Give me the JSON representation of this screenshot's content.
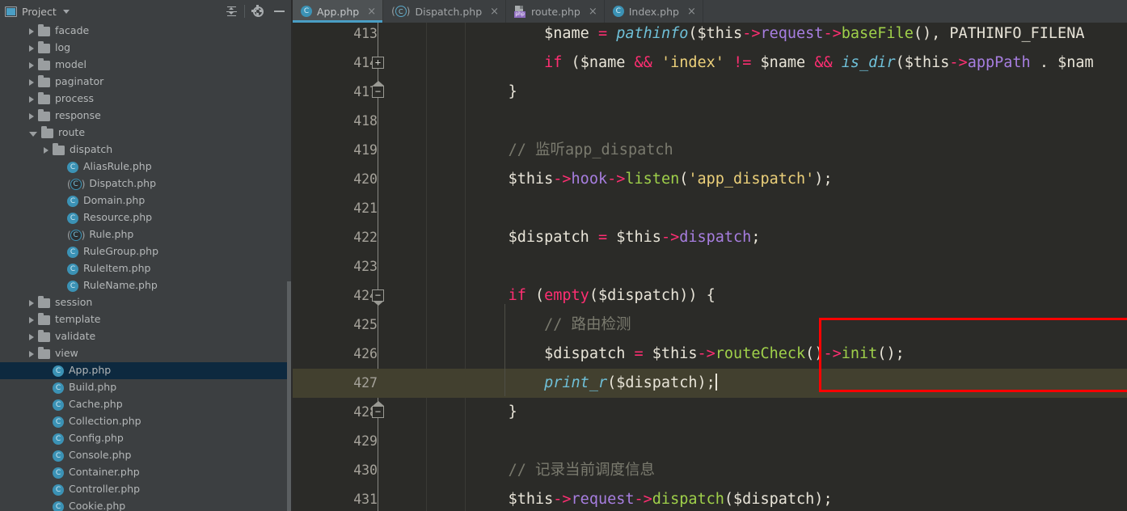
{
  "sidebar": {
    "title": "Project",
    "icons": {
      "project": "project-panel-icon",
      "collapse_all": "collapse-all-icon",
      "settings": "gear-icon",
      "minimize": "minimize-icon"
    },
    "tree": [
      {
        "label": "facade",
        "type": "folder",
        "indent": 2,
        "state": "collapsed"
      },
      {
        "label": "log",
        "type": "folder",
        "indent": 2,
        "state": "collapsed"
      },
      {
        "label": "model",
        "type": "folder",
        "indent": 2,
        "state": "collapsed"
      },
      {
        "label": "paginator",
        "type": "folder",
        "indent": 2,
        "state": "collapsed"
      },
      {
        "label": "process",
        "type": "folder",
        "indent": 2,
        "state": "collapsed"
      },
      {
        "label": "response",
        "type": "folder",
        "indent": 2,
        "state": "collapsed"
      },
      {
        "label": "route",
        "type": "folder",
        "indent": 2,
        "state": "expanded"
      },
      {
        "label": "dispatch",
        "type": "folder",
        "indent": 3,
        "state": "collapsed"
      },
      {
        "label": "AliasRule.php",
        "type": "class",
        "indent": 4,
        "state": "leaf"
      },
      {
        "label": "Dispatch.php",
        "type": "interface",
        "indent": 4,
        "state": "leaf"
      },
      {
        "label": "Domain.php",
        "type": "class",
        "indent": 4,
        "state": "leaf"
      },
      {
        "label": "Resource.php",
        "type": "class",
        "indent": 4,
        "state": "leaf"
      },
      {
        "label": "Rule.php",
        "type": "interface",
        "indent": 4,
        "state": "leaf"
      },
      {
        "label": "RuleGroup.php",
        "type": "class",
        "indent": 4,
        "state": "leaf"
      },
      {
        "label": "RuleItem.php",
        "type": "class",
        "indent": 4,
        "state": "leaf"
      },
      {
        "label": "RuleName.php",
        "type": "class",
        "indent": 4,
        "state": "leaf"
      },
      {
        "label": "session",
        "type": "folder",
        "indent": 2,
        "state": "collapsed"
      },
      {
        "label": "template",
        "type": "folder",
        "indent": 2,
        "state": "collapsed"
      },
      {
        "label": "validate",
        "type": "folder",
        "indent": 2,
        "state": "collapsed"
      },
      {
        "label": "view",
        "type": "folder",
        "indent": 2,
        "state": "collapsed"
      },
      {
        "label": "App.php",
        "type": "class",
        "indent": 3,
        "state": "leaf",
        "selected": true
      },
      {
        "label": "Build.php",
        "type": "class",
        "indent": 3,
        "state": "leaf"
      },
      {
        "label": "Cache.php",
        "type": "class",
        "indent": 3,
        "state": "leaf"
      },
      {
        "label": "Collection.php",
        "type": "class",
        "indent": 3,
        "state": "leaf"
      },
      {
        "label": "Config.php",
        "type": "class",
        "indent": 3,
        "state": "leaf"
      },
      {
        "label": "Console.php",
        "type": "class",
        "indent": 3,
        "state": "leaf"
      },
      {
        "label": "Container.php",
        "type": "class",
        "indent": 3,
        "state": "leaf"
      },
      {
        "label": "Controller.php",
        "type": "class",
        "indent": 3,
        "state": "leaf"
      },
      {
        "label": "Cookie.php",
        "type": "class",
        "indent": 3,
        "state": "leaf"
      }
    ]
  },
  "tabs": [
    {
      "label": "App.php",
      "icon": "php-class-icon",
      "active": true,
      "close": "×"
    },
    {
      "label": "Dispatch.php",
      "icon": "php-interface-icon",
      "active": false,
      "close": "×"
    },
    {
      "label": "route.php",
      "icon": "php-file-icon",
      "active": false,
      "close": "×"
    },
    {
      "label": "Index.php",
      "icon": "php-class-icon",
      "active": false,
      "close": "×"
    }
  ],
  "editor": {
    "caret_line": "427",
    "lines": [
      {
        "n": "413",
        "text": "        $name = pathinfo($this->request->baseFile(), PATHINFO_FILENA"
      },
      {
        "n": "414",
        "text": "        if ($name && 'index' != $name && is_dir($this->appPath . $nam"
      },
      {
        "n": "417",
        "text": "    }"
      },
      {
        "n": "418",
        "text": ""
      },
      {
        "n": "419",
        "text": "    // 监听app_dispatch"
      },
      {
        "n": "420",
        "text": "    $this->hook->listen('app_dispatch');"
      },
      {
        "n": "421",
        "text": ""
      },
      {
        "n": "422",
        "text": "    $dispatch = $this->dispatch;"
      },
      {
        "n": "423",
        "text": ""
      },
      {
        "n": "424",
        "text": "    if (empty($dispatch)) {"
      },
      {
        "n": "425",
        "text": "        // 路由检测"
      },
      {
        "n": "426",
        "text": "        $dispatch = $this->routeCheck()->init();"
      },
      {
        "n": "427",
        "text": "        print_r($dispatch);"
      },
      {
        "n": "428",
        "text": "    }"
      },
      {
        "n": "429",
        "text": ""
      },
      {
        "n": "430",
        "text": "    // 记录当前调度信息"
      },
      {
        "n": "431",
        "text": "    $this->request->dispatch($dispatch);"
      }
    ],
    "fold_markers": [
      {
        "line": "414",
        "glyph": "+",
        "kind": "collapsed"
      },
      {
        "line": "417",
        "glyph": "−",
        "kind": "region-end"
      },
      {
        "line": "424",
        "glyph": "−",
        "kind": "region-start"
      },
      {
        "line": "428",
        "glyph": "−",
        "kind": "region-end"
      }
    ],
    "annotation": {
      "shape": "rectangle",
      "color": "#ff0000",
      "covers_lines": [
        "426",
        "427"
      ]
    }
  },
  "colors": {
    "editor_bg": "#2b2b28",
    "panel_bg": "#3c3f41",
    "caret_line_bg": "#42402f",
    "selection_bg": "#0d293f",
    "accent": "#4a9ec4",
    "annotation": "#ff0000",
    "keyword": "#ff2e72",
    "string": "#ecd07a",
    "function": "#9fd04a",
    "property": "#a77ee0",
    "comment": "#7a7a6e",
    "builtin": "#6fc0d8"
  }
}
